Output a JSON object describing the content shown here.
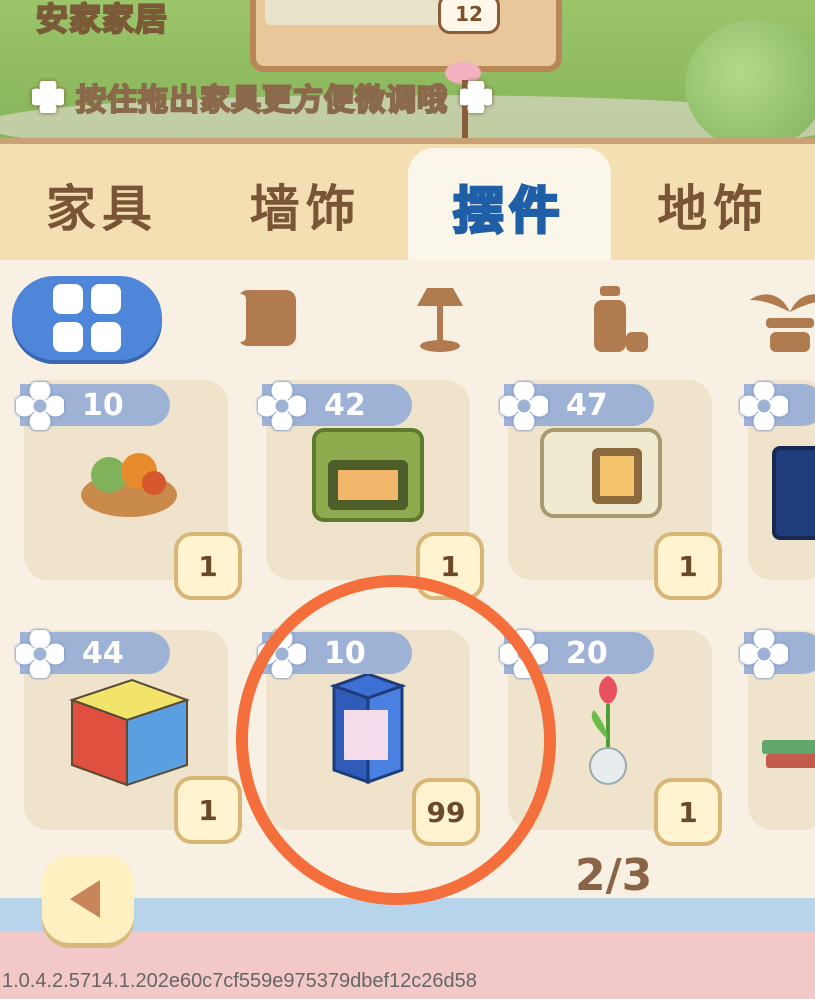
{
  "header": {
    "room_name": "安家家居",
    "hint": "按住拖出家具更方便微调哦",
    "board_badge": "12"
  },
  "tabs": [
    {
      "label": "家具",
      "active": false
    },
    {
      "label": "墙饰",
      "active": false
    },
    {
      "label": "摆件",
      "active": true
    },
    {
      "label": "地饰",
      "active": false
    }
  ],
  "subcategories": [
    {
      "icon": "grid-all-icon",
      "active": true
    },
    {
      "icon": "cushion-icon",
      "active": false
    },
    {
      "icon": "lamp-icon",
      "active": false
    },
    {
      "icon": "bottle-icon",
      "active": false
    },
    {
      "icon": "plant-pot-icon",
      "active": false
    }
  ],
  "items": [
    {
      "name": "vegetable-basket",
      "price": "10",
      "count": "1"
    },
    {
      "name": "green-oven",
      "price": "42",
      "count": "1"
    },
    {
      "name": "microwave",
      "price": "47",
      "count": "1"
    },
    {
      "name": "television",
      "price": "",
      "count": ""
    },
    {
      "name": "rubiks-cube",
      "price": "44",
      "count": "1"
    },
    {
      "name": "blind-box",
      "price": "10",
      "count": "99"
    },
    {
      "name": "tulip-vase",
      "price": "20",
      "count": "1"
    },
    {
      "name": "books",
      "price": "",
      "count": ""
    }
  ],
  "pagination": {
    "label": "2/3"
  },
  "version": "1.0.4.2.5714.1.202e60c7cf559e975379dbef12c26d58",
  "colors": {
    "accent": "#4f86d9",
    "highlight_circle": "#f46f3b"
  }
}
